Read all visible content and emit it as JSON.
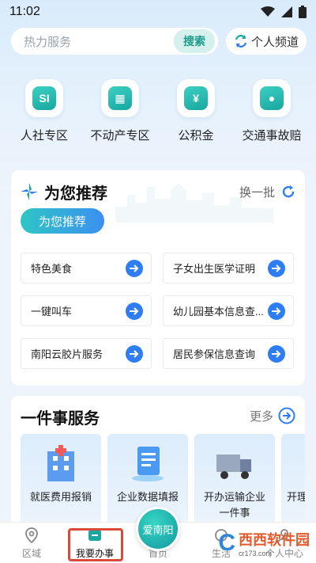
{
  "status_bar": {
    "time": "11:02"
  },
  "search": {
    "placeholder": "热力服务",
    "button_label": "搜索"
  },
  "personal_channel": {
    "label": "个人频道"
  },
  "quick_access": [
    {
      "label": "人社专区",
      "icon": "social-security-icon",
      "glyph": "SI"
    },
    {
      "label": "不动产专区",
      "icon": "building-icon",
      "glyph": "▦"
    },
    {
      "label": "公积金",
      "icon": "housing-fund-icon",
      "glyph": "¥"
    },
    {
      "label": "交通事故赔",
      "icon": "traffic-accident-icon",
      "glyph": "●"
    }
  ],
  "recommend": {
    "title": "为您推荐",
    "refresh_label": "换一批",
    "pill_label": "为您推荐",
    "items": [
      {
        "label": "特色美食"
      },
      {
        "label": "子女出生医学证明"
      },
      {
        "label": "一键叫车"
      },
      {
        "label": "幼儿园基本信息查..."
      },
      {
        "label": "南阳云胶片服务"
      },
      {
        "label": "居民参保信息查询"
      }
    ]
  },
  "services": {
    "title": "一件事服务",
    "more_label": "更多",
    "items": [
      {
        "label": "就医费用报销"
      },
      {
        "label": "企业数据填报"
      },
      {
        "label": "开办运输企业一件事"
      },
      {
        "label": "开理"
      }
    ]
  },
  "bottom_nav": [
    {
      "label": "区域",
      "icon": "location-pin-icon"
    },
    {
      "label": "我要办事",
      "icon": "task-icon"
    },
    {
      "label": "首页",
      "icon": "home-icon"
    },
    {
      "label": "生活",
      "icon": "life-icon"
    },
    {
      "label": "个人中心",
      "icon": "user-icon"
    }
  ],
  "center_button": {
    "label": "爱南阳"
  },
  "watermark": {
    "brand": "西西软件园",
    "url": "cr173.com"
  },
  "colors": {
    "accent": "#2f7df5",
    "teal": "#1ba6a0",
    "highlight": "#d94a3a"
  }
}
